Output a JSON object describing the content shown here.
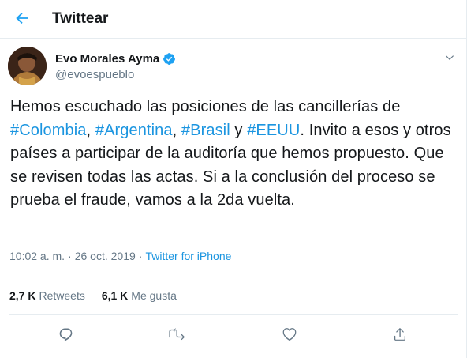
{
  "header": {
    "title": "Twittear",
    "back_icon": "arrow-left-icon"
  },
  "author": {
    "name": "Evo Morales Ayma",
    "handle": "@evoespueblo",
    "verified": true
  },
  "tweet": {
    "line1": "Hemos escuchado las posiciones de las cancillerías de",
    "hashtag_colombia": "#Colombia",
    "comma1": ", ",
    "hashtag_argentina": "#Argentina",
    "comma2": ", ",
    "hashtag_brasil": "#Brasil",
    "and": " y ",
    "hashtag_eeuu": "#EEUU",
    "rest": ". Invito a esos y otros países a participar de la auditoría que hemos propuesto. Que se revisen todas las actas. Si a la conclusión del proceso se prueba el fraude, vamos a la 2da vuelta."
  },
  "meta": {
    "time": "10:02 a. m.",
    "separator": "·",
    "date": "26 oct. 2019",
    "source": "Twitter for iPhone"
  },
  "stats": {
    "retweets_count": "2,7 K",
    "retweets_label": "Retweets",
    "likes_count": "6,1 K",
    "likes_label": "Me gusta"
  },
  "actions": [
    "reply-icon",
    "retweet-icon",
    "like-icon",
    "share-icon"
  ],
  "colors": {
    "accent": "#1b95e0",
    "text": "#14171a",
    "secondary": "#657786",
    "border": "#e6ecf0",
    "verified": "#1da1f2"
  }
}
